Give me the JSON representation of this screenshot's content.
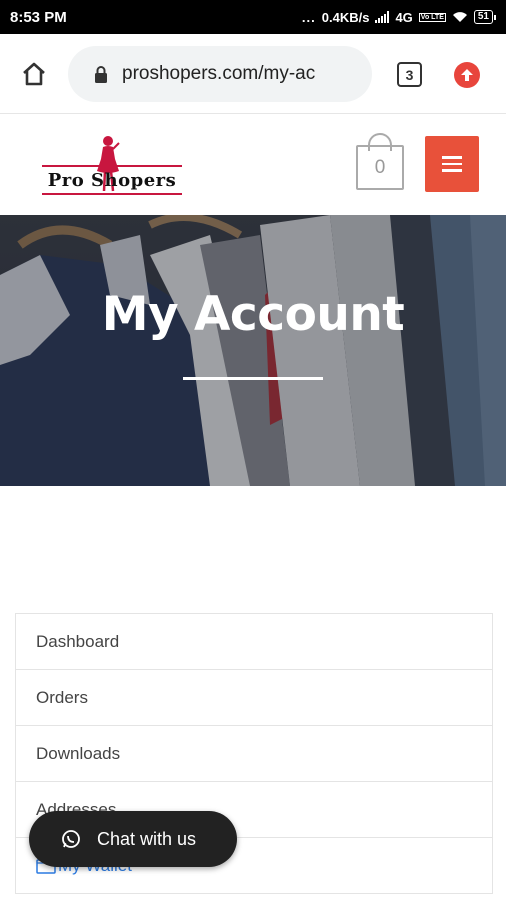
{
  "status_bar": {
    "time": "8:53 PM",
    "dots": "...",
    "net_speed": "0.4KB/s",
    "network": "4G",
    "volte": "Vo LTE",
    "battery": "51"
  },
  "browser": {
    "url": "proshopers.com/my-ac",
    "tab_count": "3"
  },
  "site": {
    "logo_text": "Pro Shopers",
    "cart_count": "0",
    "accent_color": "#e8513a"
  },
  "hero": {
    "title": "My Account"
  },
  "account_nav": {
    "items": [
      {
        "label": "Dashboard"
      },
      {
        "label": "Orders"
      },
      {
        "label": "Downloads"
      },
      {
        "label": "Addresses"
      },
      {
        "label": "My Wallet"
      }
    ]
  },
  "chat": {
    "label": "Chat with us"
  }
}
